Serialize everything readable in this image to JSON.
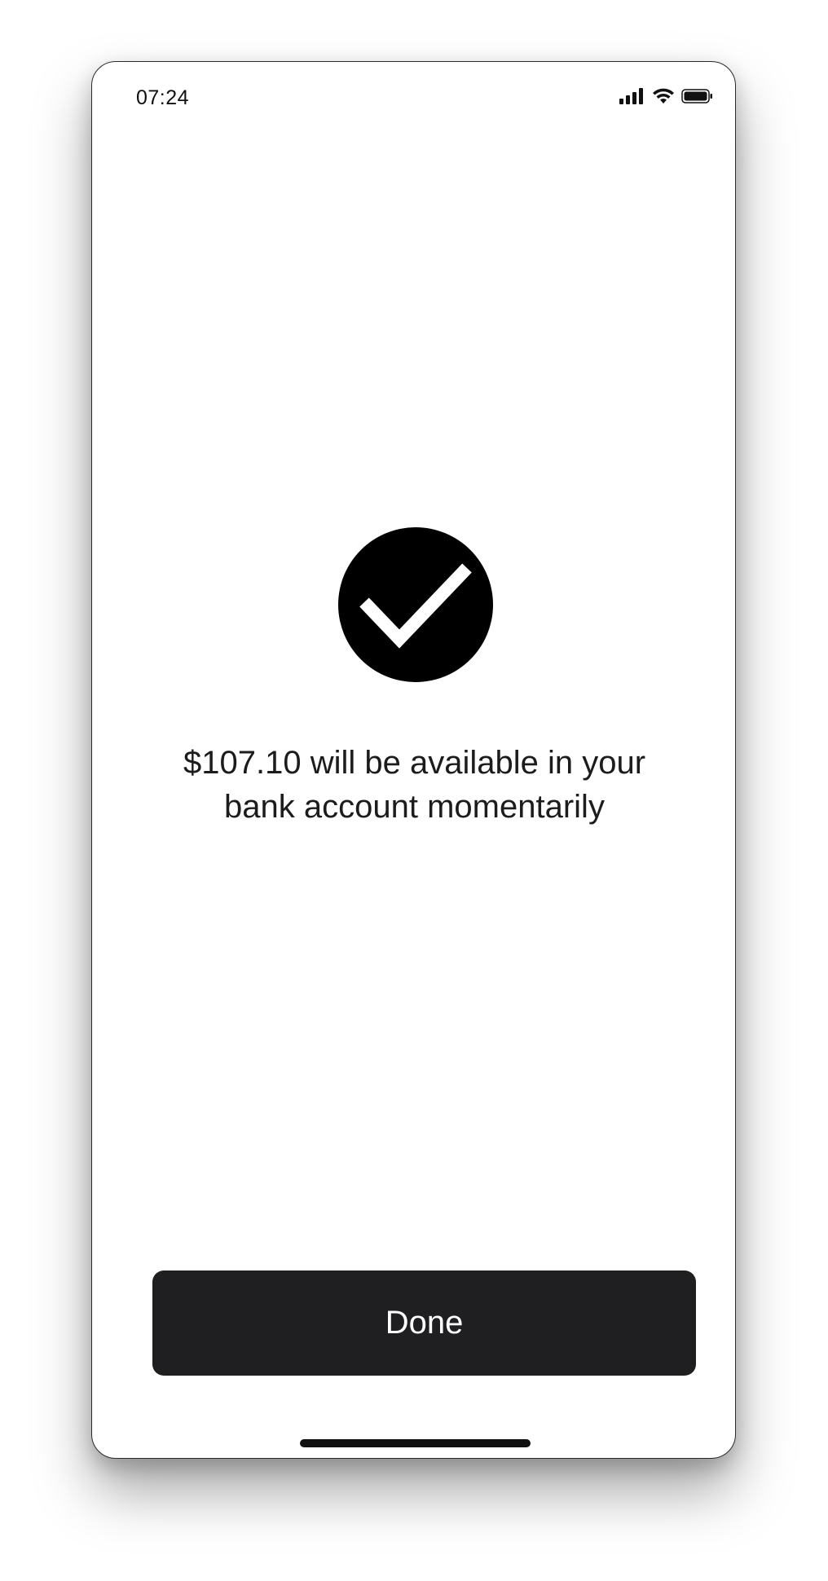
{
  "status_bar": {
    "time": "07:24",
    "icons": [
      "cellular-signal-icon",
      "wifi-icon",
      "battery-icon"
    ]
  },
  "confirmation": {
    "icon": "checkmark-circle-icon",
    "message_line1": "$107.10 will be available in your",
    "message_line2": "bank account momentarily"
  },
  "actions": {
    "done_label": "Done"
  },
  "colors": {
    "button_background": "#1f1f22",
    "icon_fill": "#000000",
    "text": "#1c1c1e",
    "background": "#ffffff"
  }
}
